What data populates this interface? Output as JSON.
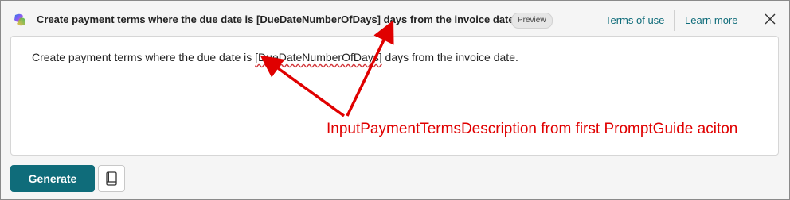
{
  "header": {
    "title": "Create payment terms where the due date is [DueDateNumberOfDays] days from the invoice date.",
    "badge": "Preview",
    "terms_link": "Terms of use",
    "learn_more_link": "Learn more"
  },
  "prompt": {
    "before": "Create payment terms where the due date is ",
    "token": "[DueDateNumberOfDays]",
    "after": " days from the invoice date."
  },
  "actions": {
    "generate_label": "Generate"
  },
  "annotation": {
    "label": "InputPaymentTermsDescription from first PromptGuide aciton",
    "color": "#e00000"
  },
  "colors": {
    "accent": "#0f6c7a",
    "spellcheck": "#d13438"
  }
}
